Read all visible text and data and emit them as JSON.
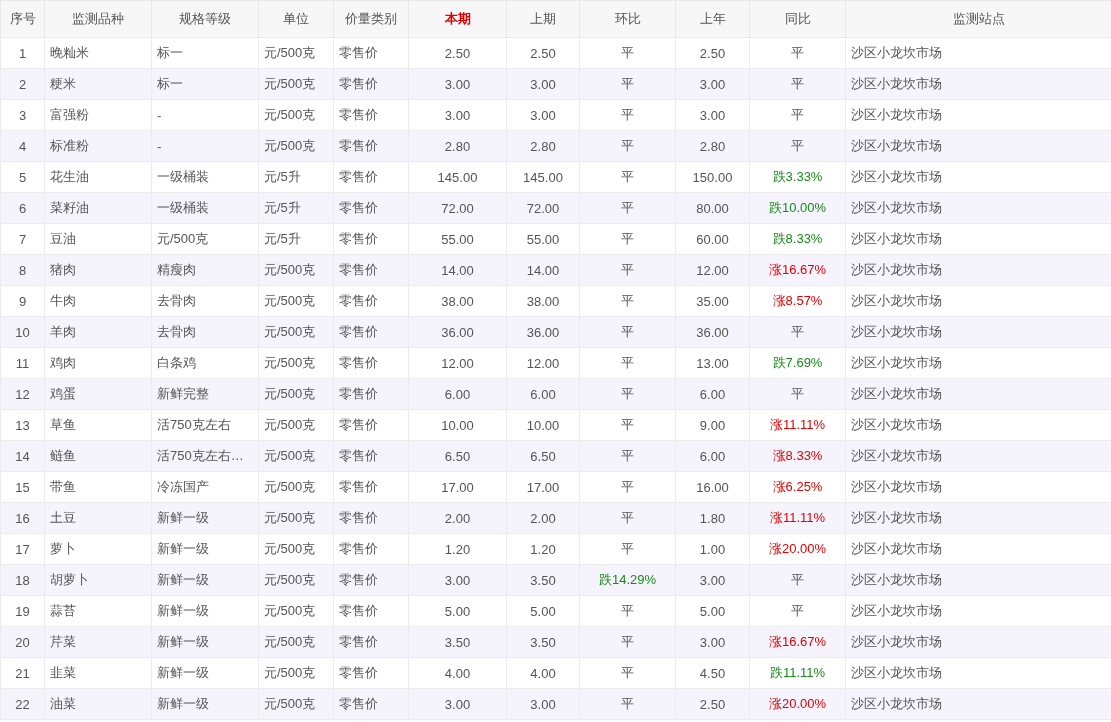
{
  "table": {
    "columns": [
      {
        "label": "序号",
        "highlight": false
      },
      {
        "label": "监测品种",
        "highlight": false
      },
      {
        "label": "规格等级",
        "highlight": false
      },
      {
        "label": "单位",
        "highlight": false
      },
      {
        "label": "价量类别",
        "highlight": false
      },
      {
        "label": "本期",
        "highlight": true
      },
      {
        "label": "上期",
        "highlight": false
      },
      {
        "label": "环比",
        "highlight": false
      },
      {
        "label": "上年",
        "highlight": false
      },
      {
        "label": "同比",
        "highlight": false
      },
      {
        "label": "监测站点",
        "highlight": false
      }
    ],
    "rows": [
      {
        "no": "1",
        "name": "晚籼米",
        "grade": "标一",
        "unit": "元/500克",
        "type": "零售价",
        "current": "2.50",
        "previous": "2.50",
        "mom": {
          "text": "平",
          "kind": "flat"
        },
        "last_year": "2.50",
        "yoy": {
          "text": "平",
          "kind": "flat"
        },
        "site": "沙区小龙坎市场"
      },
      {
        "no": "2",
        "name": "粳米",
        "grade": "标一",
        "unit": "元/500克",
        "type": "零售价",
        "current": "3.00",
        "previous": "3.00",
        "mom": {
          "text": "平",
          "kind": "flat"
        },
        "last_year": "3.00",
        "yoy": {
          "text": "平",
          "kind": "flat"
        },
        "site": "沙区小龙坎市场"
      },
      {
        "no": "3",
        "name": "富强粉",
        "grade": "-",
        "unit": "元/500克",
        "type": "零售价",
        "current": "3.00",
        "previous": "3.00",
        "mom": {
          "text": "平",
          "kind": "flat"
        },
        "last_year": "3.00",
        "yoy": {
          "text": "平",
          "kind": "flat"
        },
        "site": "沙区小龙坎市场"
      },
      {
        "no": "4",
        "name": "标准粉",
        "grade": "-",
        "unit": "元/500克",
        "type": "零售价",
        "current": "2.80",
        "previous": "2.80",
        "mom": {
          "text": "平",
          "kind": "flat"
        },
        "last_year": "2.80",
        "yoy": {
          "text": "平",
          "kind": "flat"
        },
        "site": "沙区小龙坎市场"
      },
      {
        "no": "5",
        "name": "花生油",
        "grade": "一级桶装",
        "unit": "元/5升",
        "type": "零售价",
        "current": "145.00",
        "previous": "145.00",
        "mom": {
          "text": "平",
          "kind": "flat"
        },
        "last_year": "150.00",
        "yoy": {
          "text": "跌3.33%",
          "kind": "down"
        },
        "site": "沙区小龙坎市场"
      },
      {
        "no": "6",
        "name": "菜籽油",
        "grade": "一级桶装",
        "unit": "元/5升",
        "type": "零售价",
        "current": "72.00",
        "previous": "72.00",
        "mom": {
          "text": "平",
          "kind": "flat"
        },
        "last_year": "80.00",
        "yoy": {
          "text": "跌10.00%",
          "kind": "down"
        },
        "site": "沙区小龙坎市场"
      },
      {
        "no": "7",
        "name": "豆油",
        "grade": "元/500克",
        "unit": "元/5升",
        "type": "零售价",
        "current": "55.00",
        "previous": "55.00",
        "mom": {
          "text": "平",
          "kind": "flat"
        },
        "last_year": "60.00",
        "yoy": {
          "text": "跌8.33%",
          "kind": "down"
        },
        "site": "沙区小龙坎市场"
      },
      {
        "no": "8",
        "name": "猪肉",
        "grade": "精瘦肉",
        "unit": "元/500克",
        "type": "零售价",
        "current": "14.00",
        "previous": "14.00",
        "mom": {
          "text": "平",
          "kind": "flat"
        },
        "last_year": "12.00",
        "yoy": {
          "text": "涨16.67%",
          "kind": "up"
        },
        "site": "沙区小龙坎市场"
      },
      {
        "no": "9",
        "name": "牛肉",
        "grade": "去骨肉",
        "unit": "元/500克",
        "type": "零售价",
        "current": "38.00",
        "previous": "38.00",
        "mom": {
          "text": "平",
          "kind": "flat"
        },
        "last_year": "35.00",
        "yoy": {
          "text": "涨8.57%",
          "kind": "up"
        },
        "site": "沙区小龙坎市场"
      },
      {
        "no": "10",
        "name": "羊肉",
        "grade": "去骨肉",
        "unit": "元/500克",
        "type": "零售价",
        "current": "36.00",
        "previous": "36.00",
        "mom": {
          "text": "平",
          "kind": "flat"
        },
        "last_year": "36.00",
        "yoy": {
          "text": "平",
          "kind": "flat"
        },
        "site": "沙区小龙坎市场"
      },
      {
        "no": "11",
        "name": "鸡肉",
        "grade": "白条鸡",
        "unit": "元/500克",
        "type": "零售价",
        "current": "12.00",
        "previous": "12.00",
        "mom": {
          "text": "平",
          "kind": "flat"
        },
        "last_year": "13.00",
        "yoy": {
          "text": "跌7.69%",
          "kind": "down"
        },
        "site": "沙区小龙坎市场"
      },
      {
        "no": "12",
        "name": "鸡蛋",
        "grade": "新鲜完整",
        "unit": "元/500克",
        "type": "零售价",
        "current": "6.00",
        "previous": "6.00",
        "mom": {
          "text": "平",
          "kind": "flat"
        },
        "last_year": "6.00",
        "yoy": {
          "text": "平",
          "kind": "flat"
        },
        "site": "沙区小龙坎市场"
      },
      {
        "no": "13",
        "name": "草鱼",
        "grade": "活750克左右",
        "unit": "元/500克",
        "type": "零售价",
        "current": "10.00",
        "previous": "10.00",
        "mom": {
          "text": "平",
          "kind": "flat"
        },
        "last_year": "9.00",
        "yoy": {
          "text": "涨11.11%",
          "kind": "up"
        },
        "site": "沙区小龙坎市场"
      },
      {
        "no": "14",
        "name": "鲢鱼",
        "grade": "活750克左右…",
        "unit": "元/500克",
        "type": "零售价",
        "current": "6.50",
        "previous": "6.50",
        "mom": {
          "text": "平",
          "kind": "flat"
        },
        "last_year": "6.00",
        "yoy": {
          "text": "涨8.33%",
          "kind": "up"
        },
        "site": "沙区小龙坎市场"
      },
      {
        "no": "15",
        "name": "带鱼",
        "grade": "冷冻国产",
        "unit": "元/500克",
        "type": "零售价",
        "current": "17.00",
        "previous": "17.00",
        "mom": {
          "text": "平",
          "kind": "flat"
        },
        "last_year": "16.00",
        "yoy": {
          "text": "涨6.25%",
          "kind": "up"
        },
        "site": "沙区小龙坎市场"
      },
      {
        "no": "16",
        "name": "土豆",
        "grade": "新鲜一级",
        "unit": "元/500克",
        "type": "零售价",
        "current": "2.00",
        "previous": "2.00",
        "mom": {
          "text": "平",
          "kind": "flat"
        },
        "last_year": "1.80",
        "yoy": {
          "text": "涨11.11%",
          "kind": "up"
        },
        "site": "沙区小龙坎市场"
      },
      {
        "no": "17",
        "name": "萝卜",
        "grade": "新鲜一级",
        "unit": "元/500克",
        "type": "零售价",
        "current": "1.20",
        "previous": "1.20",
        "mom": {
          "text": "平",
          "kind": "flat"
        },
        "last_year": "1.00",
        "yoy": {
          "text": "涨20.00%",
          "kind": "up"
        },
        "site": "沙区小龙坎市场"
      },
      {
        "no": "18",
        "name": "胡萝卜",
        "grade": "新鲜一级",
        "unit": "元/500克",
        "type": "零售价",
        "current": "3.00",
        "previous": "3.50",
        "mom": {
          "text": "跌14.29%",
          "kind": "down"
        },
        "last_year": "3.00",
        "yoy": {
          "text": "平",
          "kind": "flat"
        },
        "site": "沙区小龙坎市场"
      },
      {
        "no": "19",
        "name": "蒜苔",
        "grade": "新鲜一级",
        "unit": "元/500克",
        "type": "零售价",
        "current": "5.00",
        "previous": "5.00",
        "mom": {
          "text": "平",
          "kind": "flat"
        },
        "last_year": "5.00",
        "yoy": {
          "text": "平",
          "kind": "flat"
        },
        "site": "沙区小龙坎市场"
      },
      {
        "no": "20",
        "name": "芹菜",
        "grade": "新鲜一级",
        "unit": "元/500克",
        "type": "零售价",
        "current": "3.50",
        "previous": "3.50",
        "mom": {
          "text": "平",
          "kind": "flat"
        },
        "last_year": "3.00",
        "yoy": {
          "text": "涨16.67%",
          "kind": "up"
        },
        "site": "沙区小龙坎市场"
      },
      {
        "no": "21",
        "name": "韭菜",
        "grade": "新鲜一级",
        "unit": "元/500克",
        "type": "零售价",
        "current": "4.00",
        "previous": "4.00",
        "mom": {
          "text": "平",
          "kind": "flat"
        },
        "last_year": "4.50",
        "yoy": {
          "text": "跌11.11%",
          "kind": "down"
        },
        "site": "沙区小龙坎市场"
      },
      {
        "no": "22",
        "name": "油菜",
        "grade": "新鲜一级",
        "unit": "元/500克",
        "type": "零售价",
        "current": "3.00",
        "previous": "3.00",
        "mom": {
          "text": "平",
          "kind": "flat"
        },
        "last_year": "2.50",
        "yoy": {
          "text": "涨20.00%",
          "kind": "up"
        },
        "site": "沙区小龙坎市场"
      }
    ]
  }
}
